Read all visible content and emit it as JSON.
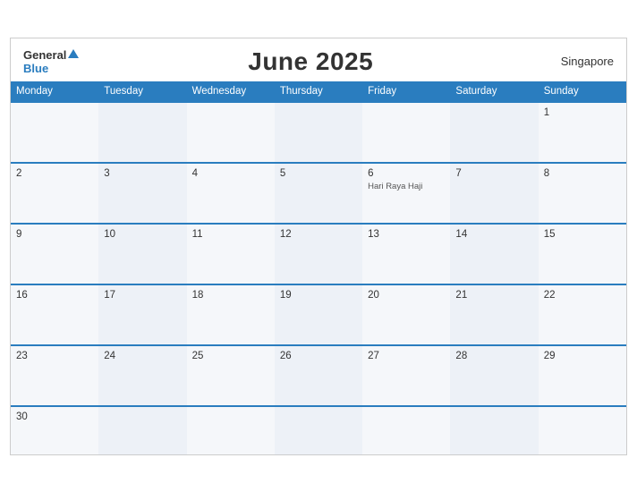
{
  "header": {
    "logo_general": "General",
    "logo_blue": "Blue",
    "month_title": "June 2025",
    "country": "Singapore"
  },
  "days": {
    "headers": [
      "Monday",
      "Tuesday",
      "Wednesday",
      "Thursday",
      "Friday",
      "Saturday",
      "Sunday"
    ]
  },
  "weeks": [
    {
      "cells": [
        {
          "num": "",
          "holiday": ""
        },
        {
          "num": "",
          "holiday": ""
        },
        {
          "num": "",
          "holiday": ""
        },
        {
          "num": "",
          "holiday": ""
        },
        {
          "num": "",
          "holiday": ""
        },
        {
          "num": "",
          "holiday": ""
        },
        {
          "num": "1",
          "holiday": ""
        }
      ]
    },
    {
      "cells": [
        {
          "num": "2",
          "holiday": ""
        },
        {
          "num": "3",
          "holiday": ""
        },
        {
          "num": "4",
          "holiday": ""
        },
        {
          "num": "5",
          "holiday": ""
        },
        {
          "num": "6",
          "holiday": "Hari Raya Haji"
        },
        {
          "num": "7",
          "holiday": ""
        },
        {
          "num": "8",
          "holiday": ""
        }
      ]
    },
    {
      "cells": [
        {
          "num": "9",
          "holiday": ""
        },
        {
          "num": "10",
          "holiday": ""
        },
        {
          "num": "11",
          "holiday": ""
        },
        {
          "num": "12",
          "holiday": ""
        },
        {
          "num": "13",
          "holiday": ""
        },
        {
          "num": "14",
          "holiday": ""
        },
        {
          "num": "15",
          "holiday": ""
        }
      ]
    },
    {
      "cells": [
        {
          "num": "16",
          "holiday": ""
        },
        {
          "num": "17",
          "holiday": ""
        },
        {
          "num": "18",
          "holiday": ""
        },
        {
          "num": "19",
          "holiday": ""
        },
        {
          "num": "20",
          "holiday": ""
        },
        {
          "num": "21",
          "holiday": ""
        },
        {
          "num": "22",
          "holiday": ""
        }
      ]
    },
    {
      "cells": [
        {
          "num": "23",
          "holiday": ""
        },
        {
          "num": "24",
          "holiday": ""
        },
        {
          "num": "25",
          "holiday": ""
        },
        {
          "num": "26",
          "holiday": ""
        },
        {
          "num": "27",
          "holiday": ""
        },
        {
          "num": "28",
          "holiday": ""
        },
        {
          "num": "29",
          "holiday": ""
        }
      ]
    },
    {
      "cells": [
        {
          "num": "30",
          "holiday": ""
        },
        {
          "num": "",
          "holiday": ""
        },
        {
          "num": "",
          "holiday": ""
        },
        {
          "num": "",
          "holiday": ""
        },
        {
          "num": "",
          "holiday": ""
        },
        {
          "num": "",
          "holiday": ""
        },
        {
          "num": "",
          "holiday": ""
        }
      ]
    }
  ]
}
